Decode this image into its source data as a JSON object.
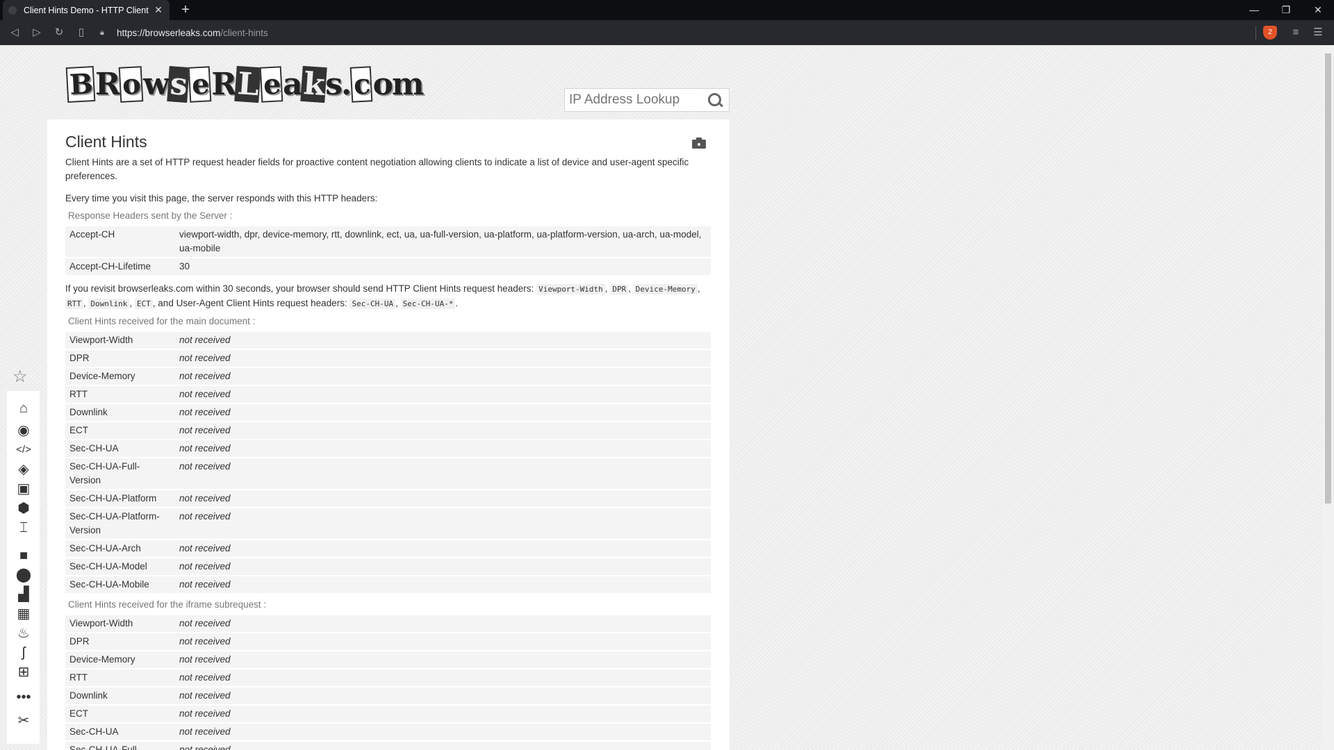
{
  "browser": {
    "tab_title": "Client Hints Demo - HTTP Client",
    "new_tab": "+",
    "url_host": "https://browserleaks.com",
    "url_path": "/client-hints",
    "shield_count": "2"
  },
  "site": {
    "logo": "BrowserLeaks.com",
    "search_placeholder": "IP Address Lookup"
  },
  "page": {
    "title": "Client Hints",
    "intro": "Client Hints are a set of HTTP request header fields for proactive content negotiation allowing clients to indicate a list of device and user-agent specific preferences.",
    "visit_text": "Every time you visit this page, the server responds with this HTTP headers:",
    "response_caption": "Response Headers sent by the Server :",
    "response_headers": [
      {
        "name": "Accept-CH",
        "value": "viewport-width, dpr, device-memory, rtt, downlink, ect, ua, ua-full-version, ua-platform, ua-platform-version, ua-arch, ua-model, ua-mobile"
      },
      {
        "name": "Accept-CH-Lifetime",
        "value": "30"
      }
    ],
    "revisit": {
      "t1": "If you revisit browserleaks.com within 30 seconds, your browser should send HTTP Client Hints request headers:",
      "c1": "Viewport-Width",
      "c2": "DPR",
      "c3": "Device-Memory",
      "c4": "RTT",
      "c5": "Downlink",
      "c6": "ECT",
      "t2": ", and User-Agent Client Hints request headers:",
      "c7": "Sec-CH-UA",
      "c8": "Sec-CH-UA-*",
      "sep": ",",
      "end": "."
    },
    "main_caption": "Client Hints received for the main document :",
    "main_rows": [
      {
        "name": "Viewport-Width",
        "value": "not received"
      },
      {
        "name": "DPR",
        "value": "not received"
      },
      {
        "name": "Device-Memory",
        "value": "not received"
      },
      {
        "name": "RTT",
        "value": "not received"
      },
      {
        "name": "Downlink",
        "value": "not received"
      },
      {
        "name": "ECT",
        "value": "not received"
      },
      {
        "name": "Sec-CH-UA",
        "value": "not received"
      },
      {
        "name": "Sec-CH-UA-Full-Version",
        "value": "not received"
      },
      {
        "name": "Sec-CH-UA-Platform",
        "value": "not received"
      },
      {
        "name": "Sec-CH-UA-Platform-Version",
        "value": "not received"
      },
      {
        "name": "Sec-CH-UA-Arch",
        "value": "not received"
      },
      {
        "name": "Sec-CH-UA-Model",
        "value": "not received"
      },
      {
        "name": "Sec-CH-UA-Mobile",
        "value": "not received"
      }
    ],
    "iframe_caption": "Client Hints received for the iframe subrequest :",
    "iframe_rows": [
      {
        "name": "Viewport-Width",
        "value": "not received"
      },
      {
        "name": "DPR",
        "value": "not received"
      },
      {
        "name": "Device-Memory",
        "value": "not received"
      },
      {
        "name": "RTT",
        "value": "not received"
      },
      {
        "name": "Downlink",
        "value": "not received"
      },
      {
        "name": "ECT",
        "value": "not received"
      },
      {
        "name": "Sec-CH-UA",
        "value": "not received"
      },
      {
        "name": "Sec-CH-UA-Full-Version",
        "value": "not received"
      }
    ]
  },
  "sidebar_icons": [
    "pin-icon",
    "home-icon",
    "broadcast-icon",
    "code-icon",
    "camera-icon",
    "image-icon",
    "cube-icon",
    "text-icon",
    "lock-icon",
    "location-icon",
    "chart-icon",
    "firewall-icon",
    "java-icon",
    "flash-icon",
    "windows-icon",
    "more-icon",
    "tools-icon"
  ]
}
